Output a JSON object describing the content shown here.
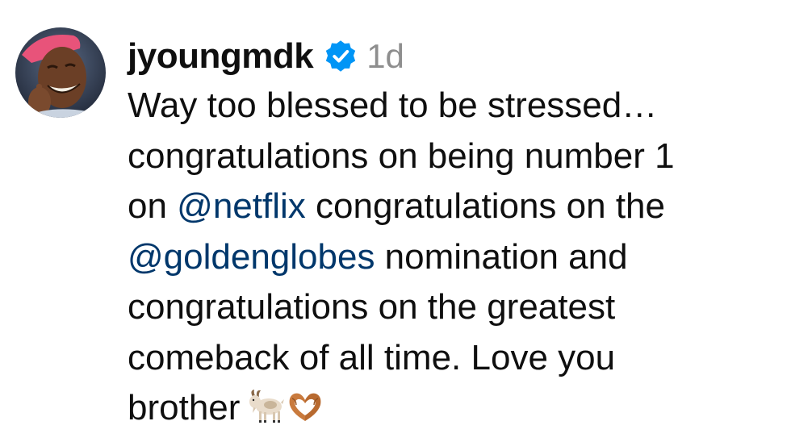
{
  "comment": {
    "username": "jyoungmdk",
    "verified": true,
    "timestamp": "1d",
    "lines": {
      "l1": "Way too blessed to be stressed…",
      "l2": "congratulations on being number 1",
      "l3_pre": "on ",
      "l3_mention": "@netflix",
      "l3_post": " congratulations on the",
      "l4_mention": "@goldenglobes",
      "l4_post": " nomination and",
      "l5": "congratulations on the greatest",
      "l6": "comeback of all time. Love you",
      "l7": "brother"
    },
    "emojis": [
      "goat-emoji",
      "heart-hands-emoji"
    ]
  },
  "colors": {
    "text": "#0f0f0f",
    "mention": "#00376b",
    "timestamp": "#8e8e8e",
    "verified_badge": "#0095f6"
  }
}
